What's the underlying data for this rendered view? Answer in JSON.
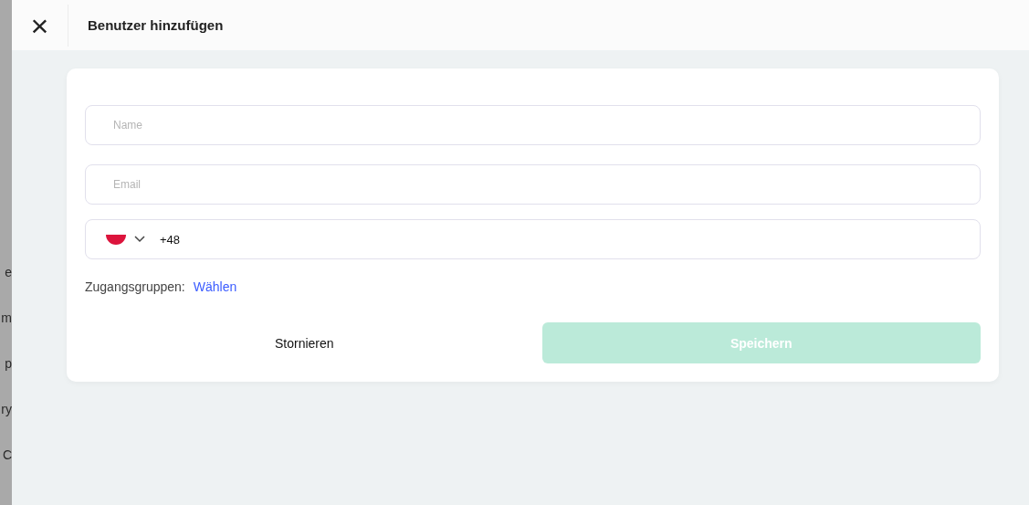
{
  "background_fragments": [
    {
      "text": "e"
    },
    {
      "text": "m"
    },
    {
      "text": "p"
    },
    {
      "text": "ry"
    },
    {
      "text": "C"
    }
  ],
  "header": {
    "close": "×",
    "title": "Benutzer hinzufügen"
  },
  "form": {
    "name": {
      "placeholder": "Name"
    },
    "email": {
      "placeholder": "Email"
    },
    "phone": {
      "value": "+48"
    },
    "access_groups": {
      "label": "Zugangsgruppen:",
      "link": "Wählen"
    },
    "buttons": [
      {
        "label": "Stornieren",
        "kind": "cancel",
        "disabled": false
      },
      {
        "label": "Speichern",
        "kind": "save",
        "disabled": true
      }
    ]
  }
}
